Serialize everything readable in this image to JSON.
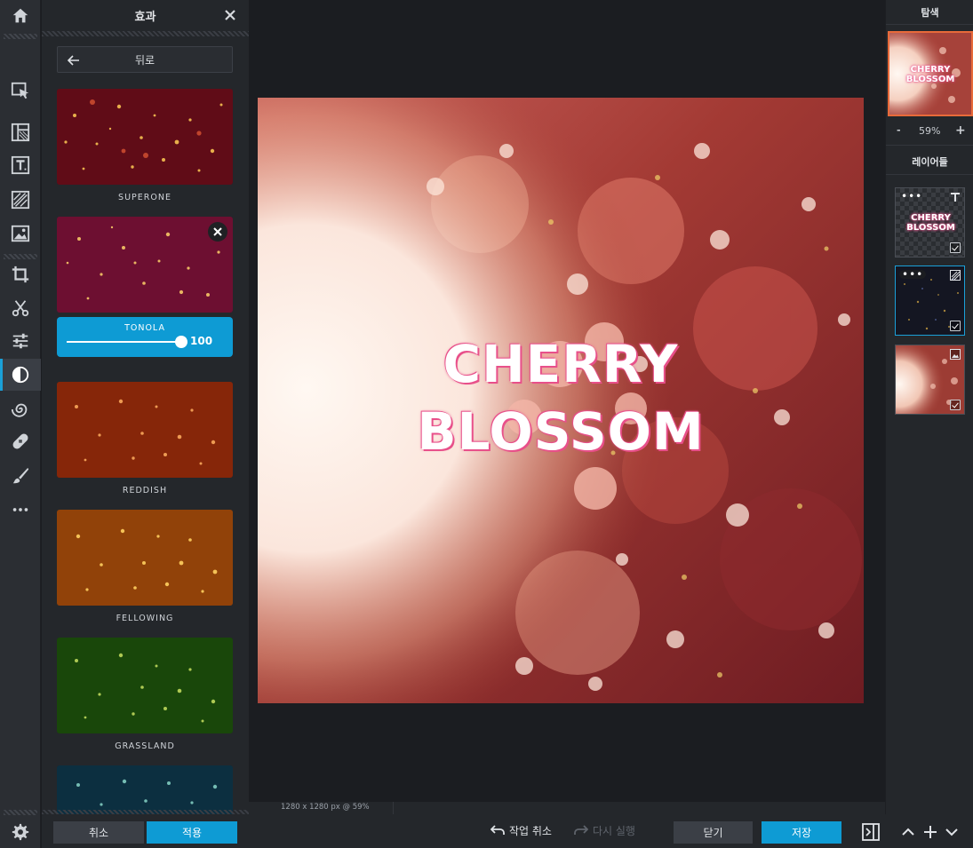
{
  "panel": {
    "title": "효과",
    "back_label": "뒤로",
    "effects": [
      {
        "name": "SUPERONE"
      },
      {
        "name": "TONOLA",
        "active": true,
        "intensity": 100
      },
      {
        "name": "REDDISH"
      },
      {
        "name": "FELLOWING"
      },
      {
        "name": "GRASSLAND"
      }
    ],
    "cancel_label": "취소",
    "apply_label": "적용"
  },
  "canvas": {
    "title_line1": "CHERRY",
    "title_line2": "BLOSSOM",
    "status": "1280 x 1280 px @ 59%"
  },
  "bottom": {
    "undo_label": "작업 취소",
    "redo_label": "다시 실행",
    "close_label": "닫기",
    "save_label": "저장"
  },
  "right": {
    "navigator_title": "탐색",
    "zoom_minus": "-",
    "zoom": "59%",
    "zoom_plus": "+",
    "layers_title": "레이어들",
    "layers": [
      {
        "type": "text",
        "text_line1": "CHERRY",
        "text_line2": "BLOSSOM"
      },
      {
        "type": "effect",
        "selected": true
      },
      {
        "type": "image"
      }
    ]
  },
  "colors": {
    "accent": "#0e9bd4",
    "panel": "#24272b",
    "toolbar": "#2b2e33",
    "canvas_bg": "#1b1d21",
    "text_glow": "#e8508a"
  },
  "icons": [
    "home-icon",
    "select-icon",
    "layout-icon",
    "text-icon",
    "texture-icon",
    "image-icon",
    "crop-icon",
    "cut-icon",
    "adjust-icon",
    "effects-icon",
    "swirl-icon",
    "bandage-icon",
    "brush-icon",
    "more-icon",
    "gear-icon"
  ]
}
